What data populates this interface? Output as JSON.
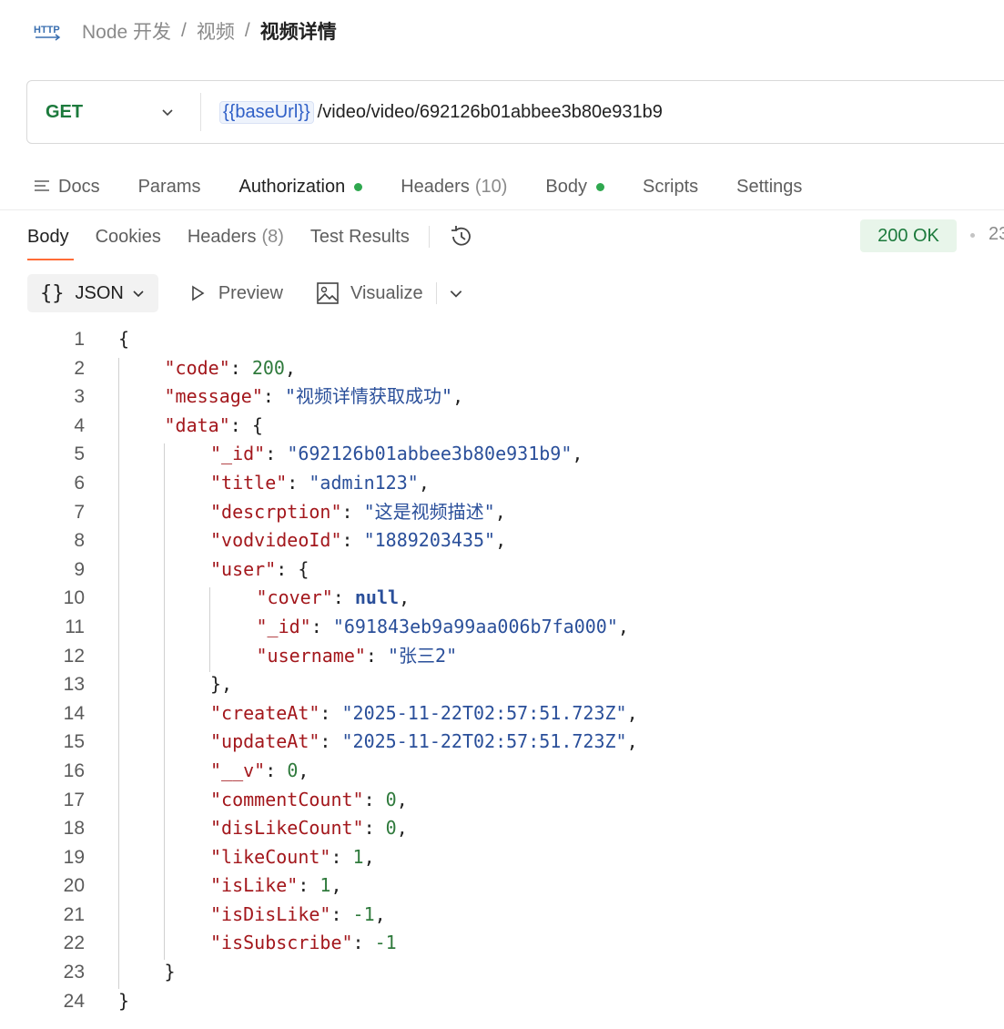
{
  "breadcrumb": {
    "icon_text": "HTTP",
    "items": [
      "Node 开发",
      "视频"
    ],
    "separator": "/",
    "current": "视频详情"
  },
  "request": {
    "method": "GET",
    "url_variable": "{{baseUrl}}",
    "url_path": "/video/video/692126b01abbee3b80e931b9"
  },
  "request_tabs": {
    "docs": "Docs",
    "params": "Params",
    "authorization": "Authorization",
    "headers": "Headers",
    "headers_count": "(10)",
    "body": "Body",
    "scripts": "Scripts",
    "settings": "Settings"
  },
  "response_tabs": {
    "body": "Body",
    "cookies": "Cookies",
    "headers": "Headers",
    "headers_count": "(8)",
    "test_results": "Test Results"
  },
  "status": {
    "text": "200 OK",
    "time_partial": "23"
  },
  "view": {
    "json": "JSON",
    "preview": "Preview",
    "visualize": "Visualize"
  },
  "colors": {
    "method_green": "#1c7a3c",
    "active_underline": "#ff6c37",
    "key_red": "#a3171c",
    "string_blue": "#2a4f9a",
    "number_green": "#2f7a3c"
  },
  "code_lines": [
    [
      [
        "pun",
        "{"
      ]
    ],
    [
      [
        "key",
        "\"code\""
      ],
      [
        "pun",
        ": "
      ],
      [
        "num",
        "200"
      ],
      [
        "pun",
        ","
      ]
    ],
    [
      [
        "key",
        "\"message\""
      ],
      [
        "pun",
        ": "
      ],
      [
        "str",
        "\"视频详情获取成功\""
      ],
      [
        "pun",
        ","
      ]
    ],
    [
      [
        "key",
        "\"data\""
      ],
      [
        "pun",
        ": {"
      ]
    ],
    [
      [
        "key",
        "\"_id\""
      ],
      [
        "pun",
        ": "
      ],
      [
        "str",
        "\"692126b01abbee3b80e931b9\""
      ],
      [
        "pun",
        ","
      ]
    ],
    [
      [
        "key",
        "\"title\""
      ],
      [
        "pun",
        ": "
      ],
      [
        "str",
        "\"admin123\""
      ],
      [
        "pun",
        ","
      ]
    ],
    [
      [
        "key",
        "\"descrption\""
      ],
      [
        "pun",
        ": "
      ],
      [
        "str",
        "\"这是视频描述\""
      ],
      [
        "pun",
        ","
      ]
    ],
    [
      [
        "key",
        "\"vodvideoId\""
      ],
      [
        "pun",
        ": "
      ],
      [
        "str",
        "\"1889203435\""
      ],
      [
        "pun",
        ","
      ]
    ],
    [
      [
        "key",
        "\"user\""
      ],
      [
        "pun",
        ": {"
      ]
    ],
    [
      [
        "key",
        "\"cover\""
      ],
      [
        "pun",
        ": "
      ],
      [
        "kw",
        "null"
      ],
      [
        "pun",
        ","
      ]
    ],
    [
      [
        "key",
        "\"_id\""
      ],
      [
        "pun",
        ": "
      ],
      [
        "str",
        "\"691843eb9a99aa006b7fa000\""
      ],
      [
        "pun",
        ","
      ]
    ],
    [
      [
        "key",
        "\"username\""
      ],
      [
        "pun",
        ": "
      ],
      [
        "str",
        "\"张三2\""
      ]
    ],
    [
      [
        "pun",
        "},"
      ]
    ],
    [
      [
        "key",
        "\"createAt\""
      ],
      [
        "pun",
        ": "
      ],
      [
        "str",
        "\"2025-11-22T02:57:51.723Z\""
      ],
      [
        "pun",
        ","
      ]
    ],
    [
      [
        "key",
        "\"updateAt\""
      ],
      [
        "pun",
        ": "
      ],
      [
        "str",
        "\"2025-11-22T02:57:51.723Z\""
      ],
      [
        "pun",
        ","
      ]
    ],
    [
      [
        "key",
        "\"__v\""
      ],
      [
        "pun",
        ": "
      ],
      [
        "num",
        "0"
      ],
      [
        "pun",
        ","
      ]
    ],
    [
      [
        "key",
        "\"commentCount\""
      ],
      [
        "pun",
        ": "
      ],
      [
        "num",
        "0"
      ],
      [
        "pun",
        ","
      ]
    ],
    [
      [
        "key",
        "\"disLikeCount\""
      ],
      [
        "pun",
        ": "
      ],
      [
        "num",
        "0"
      ],
      [
        "pun",
        ","
      ]
    ],
    [
      [
        "key",
        "\"likeCount\""
      ],
      [
        "pun",
        ": "
      ],
      [
        "num",
        "1"
      ],
      [
        "pun",
        ","
      ]
    ],
    [
      [
        "key",
        "\"isLike\""
      ],
      [
        "pun",
        ": "
      ],
      [
        "num",
        "1"
      ],
      [
        "pun",
        ","
      ]
    ],
    [
      [
        "key",
        "\"isDisLike\""
      ],
      [
        "pun",
        ": "
      ],
      [
        "num",
        "-1"
      ],
      [
        "pun",
        ","
      ]
    ],
    [
      [
        "key",
        "\"isSubscribe\""
      ],
      [
        "pun",
        ": "
      ],
      [
        "num",
        "-1"
      ]
    ],
    [
      [
        "pun",
        "}"
      ]
    ],
    [
      [
        "pun",
        "}"
      ]
    ]
  ]
}
